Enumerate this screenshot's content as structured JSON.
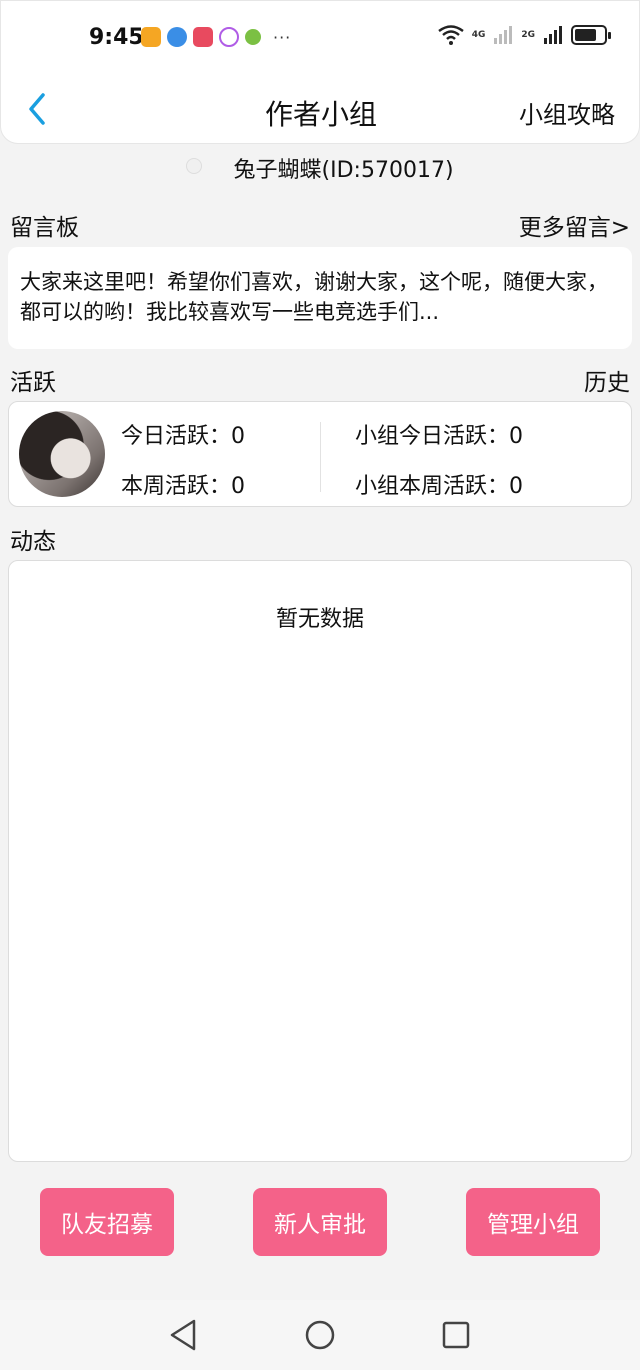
{
  "status_bar": {
    "time": "9:45",
    "more": "···",
    "network_1": "4G",
    "network_2": "2G",
    "battery_level": 0.75,
    "app_icons": [
      "tasks-app-icon",
      "browser-app-icon",
      "book-app-icon",
      "music-app-icon",
      "bird-app-icon"
    ]
  },
  "header": {
    "title": "作者小组",
    "guide_label": "小组攻略"
  },
  "user": {
    "name": "兔子蝴蝶(ID:570017)"
  },
  "board": {
    "title": "留言板",
    "more_label": "更多留言>",
    "message": "大家来这里吧！希望你们喜欢，谢谢大家，这个呢，随便大家，都可以的哟！我比较喜欢写一些电竞选手们..."
  },
  "active": {
    "title": "活跃",
    "history_label": "历史",
    "today_label": "今日活跃：",
    "today_value": "0",
    "week_label": "本周活跃：",
    "week_value": "0",
    "group_today_label": "小组今日活跃：",
    "group_today_value": "0",
    "group_week_label": "小组本周活跃：",
    "group_week_value": "0"
  },
  "feed": {
    "title": "动态",
    "empty_text": "暂无数据"
  },
  "actions": {
    "recruit_label": "队友招募",
    "approve_label": "新人审批",
    "manage_label": "管理小组"
  },
  "colors": {
    "accent_pink": "#f46289",
    "back_blue": "#1a9fe0"
  }
}
